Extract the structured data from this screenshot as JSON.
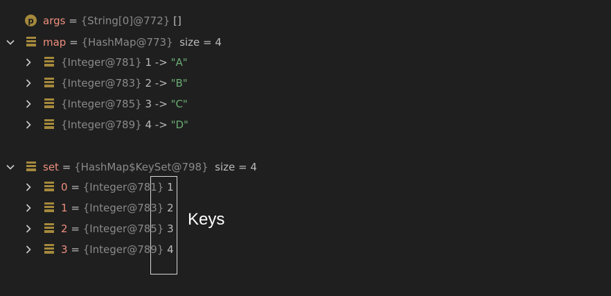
{
  "variables": {
    "args": {
      "name": "args",
      "eq": "=",
      "ref": "{String[0]@772}",
      "value": "[]",
      "icon_letter": "p"
    },
    "map": {
      "name": "map",
      "eq": "=",
      "ref": "{HashMap@773}",
      "value": "size = 4",
      "entries": [
        {
          "ref": "{Integer@781}",
          "value": "1 -> \"A\"",
          "key": "1",
          "arrow": "->",
          "str": "\"A\""
        },
        {
          "ref": "{Integer@783}",
          "value": "2 -> \"B\"",
          "key": "2",
          "arrow": "->",
          "str": "\"B\""
        },
        {
          "ref": "{Integer@785}",
          "value": "3 -> \"C\"",
          "key": "3",
          "arrow": "->",
          "str": "\"C\""
        },
        {
          "ref": "{Integer@789}",
          "value": "4 -> \"D\"",
          "key": "4",
          "arrow": "->",
          "str": "\"D\""
        }
      ]
    },
    "set": {
      "name": "set",
      "eq": "=",
      "ref": "{HashMap$KeySet@798}",
      "value": "size = 4",
      "entries": [
        {
          "index": "0",
          "eq": "=",
          "ref": "{Integer@781}",
          "value": "1"
        },
        {
          "index": "1",
          "eq": "=",
          "ref": "{Integer@783}",
          "value": "2"
        },
        {
          "index": "2",
          "eq": "=",
          "ref": "{Integer@785}",
          "value": "3"
        },
        {
          "index": "3",
          "eq": "=",
          "ref": "{Integer@789}",
          "value": "4"
        }
      ]
    }
  },
  "annotation": {
    "label": "Keys"
  },
  "colors": {
    "background": "#1f1f1f",
    "field_icon": "#a5893c",
    "name": "#ef8f7e",
    "string": "#6aab73",
    "reference": "#8a8a8a"
  },
  "icons": {
    "expand_collapsed": "chevron-right-icon",
    "expand_open": "chevron-down-icon",
    "parameter": "parameter-icon",
    "field": "field-icon"
  }
}
